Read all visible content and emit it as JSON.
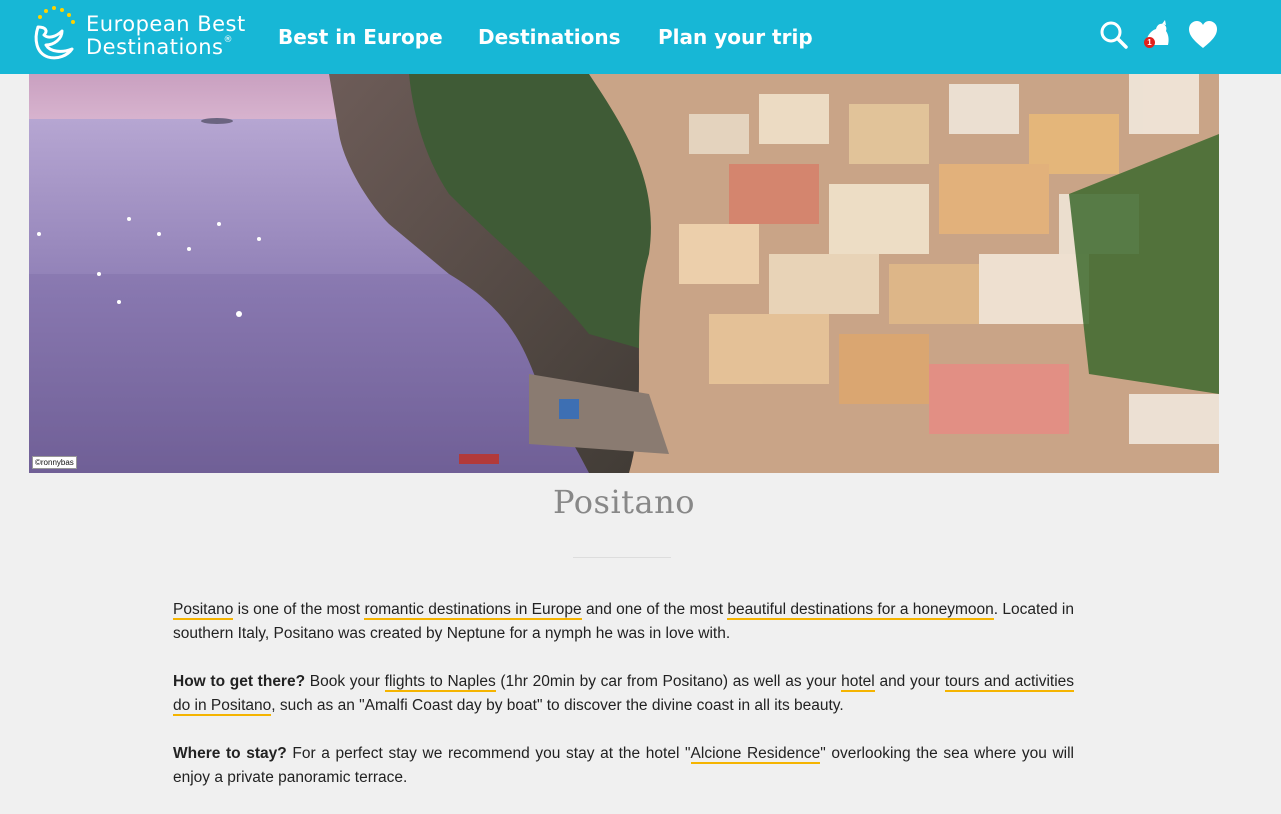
{
  "header": {
    "logo_line1": "European Best",
    "logo_line2": "Destinations",
    "logo_reg": "®",
    "nav": [
      "Best in Europe",
      "Destinations",
      "Plan your trip"
    ],
    "notification_count": "1"
  },
  "hero": {
    "credit": "©ronnybas"
  },
  "article": {
    "title": "Positano",
    "p1": {
      "link_positano": "Positano",
      "t1": " is one of the most ",
      "link_romantic": "romantic destinations in Europe",
      "t2": " and one of the most ",
      "link_beautiful": "beautiful destinations for a honeymoon",
      "t3": ". Located in southern Italy, Positano was created by Neptune for a nymph he was in love with."
    },
    "p2": {
      "label": "How to get there?",
      "t1": " Book your ",
      "link_flights": "flights to Naples",
      "t2": " (1hr 20min by car from Positano) as well as your ",
      "link_hotel": "hotel",
      "t3": " and your ",
      "link_tours": "tours and activities do in Positano",
      "t4": ", such as an \"Amalfi Coast day by boat\" to discover the divine coast in all its beauty."
    },
    "p3": {
      "label": "Where to stay?",
      "t1": " For a perfect stay we recommend you stay at the hotel \"",
      "link_alcione": "Alcione Residence",
      "t2": "\" overlooking the sea where you will enjoy a private panoramic terrace."
    }
  },
  "colors": {
    "header_bg": "#17b7d6",
    "link_underline": "#f5b400",
    "page_bg": "#f0f0f0",
    "title_color": "#888888"
  },
  "icons": [
    "logo-swallow-icon",
    "search-icon",
    "notification-icon",
    "heart-icon"
  ]
}
